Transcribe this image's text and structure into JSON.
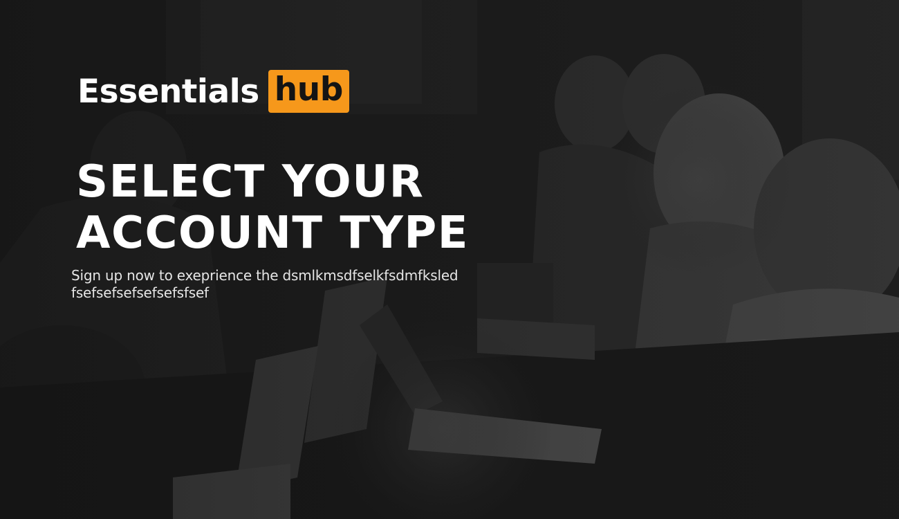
{
  "brand": {
    "name_part1": "Essentials",
    "name_part2": "hub",
    "accent_color": "#f6981b",
    "text_color": "#ffffff"
  },
  "hero": {
    "headline_line1": "SELECT YOUR",
    "headline_line2": "ACCOUNT TYPE",
    "subtitle_line1": "Sign up now to exeprience the dsmlkmsdfselkfsdmfksled",
    "subtitle_line2": "fsefsefsefsefsefsfsef",
    "background_image": "dark-office-people-with-laptops-photo"
  }
}
